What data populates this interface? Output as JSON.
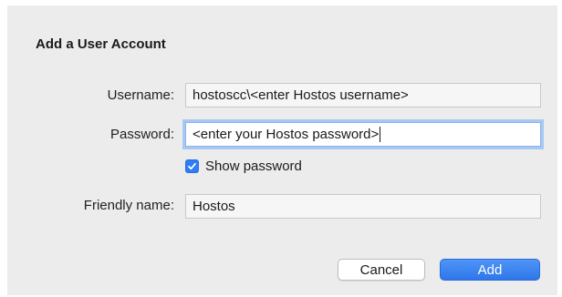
{
  "dialog": {
    "title": "Add a User Account",
    "username": {
      "label": "Username:",
      "value": "hostoscc\\<enter Hostos username>"
    },
    "password": {
      "label": "Password:",
      "value": "<enter your Hostos password>"
    },
    "show_password": {
      "label": "Show password",
      "checked": true
    },
    "friendly_name": {
      "label": "Friendly name:",
      "value": "Hostos"
    },
    "buttons": {
      "cancel": "Cancel",
      "add": "Add"
    }
  },
  "colors": {
    "dialog_background": "#ececec",
    "accent": "#2f7cf6",
    "focus_ring": "#a8c8f3"
  }
}
